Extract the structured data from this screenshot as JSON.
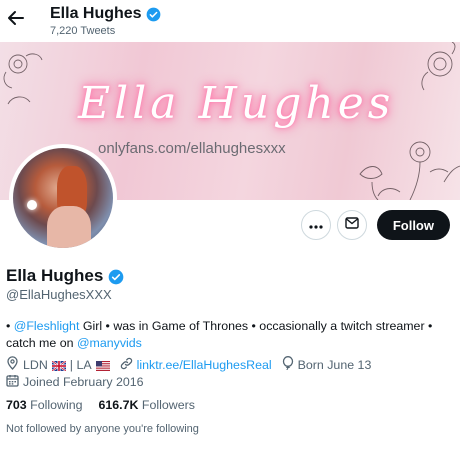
{
  "header": {
    "title": "Ella Hughes",
    "tweet_count": "7,220 Tweets"
  },
  "banner": {
    "script_text": "Ella Hughes",
    "url_text": "onlyfans.com/ellahughesxxx"
  },
  "actions": {
    "more_icon": "more-icon",
    "message_icon": "envelope-icon",
    "follow_label": "Follow"
  },
  "profile": {
    "name": "Ella Hughes",
    "handle": "@EllaHughesXXX",
    "bio_prefix": "• ",
    "bio_mention1": "@Fleshlight",
    "bio_middle": " Girl • was in Game of Thrones • occasionally a twitch streamer • catch me on ",
    "bio_mention2": "@manyvids",
    "location": "LDN",
    "location_sep": "| LA",
    "website": "linktr.ee/EllaHughesReal",
    "born": "Born June 13",
    "joined": "Joined February 2016"
  },
  "stats": {
    "following_count": "703",
    "following_label": "Following",
    "followers_count": "616.7K",
    "followers_label": "Followers"
  },
  "not_followed_text": "Not followed by anyone you're following",
  "colors": {
    "accent": "#1d9bf0",
    "text": "#0f1419",
    "secondary": "#536471",
    "follow_bg": "#0f1419"
  }
}
